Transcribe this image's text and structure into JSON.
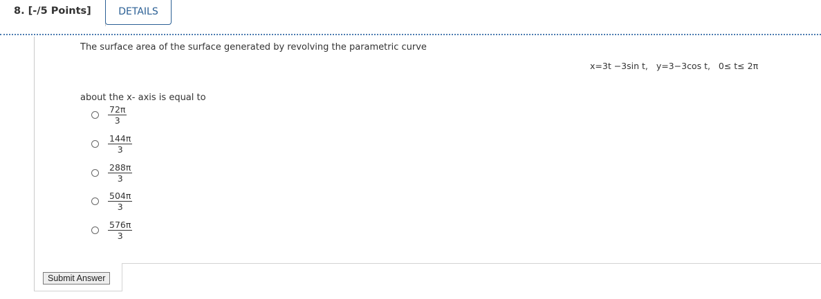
{
  "header": {
    "question_label": "8. [-/5 Points]",
    "details_label": "DETAILS"
  },
  "question": {
    "prompt": "The surface area of the surface generated by revolving the parametric curve",
    "eq_x": "x=3t −3sin t,",
    "eq_y": "y=3−3cos t,",
    "eq_range": "0≤ t≤ 2π",
    "axis_text": "about the  x- axis is equal to"
  },
  "options": [
    {
      "numerator": "72π",
      "denominator": "3",
      "selected": false
    },
    {
      "numerator": "144π",
      "denominator": "3",
      "selected": false
    },
    {
      "numerator": "288π",
      "denominator": "3",
      "selected": false
    },
    {
      "numerator": "504π",
      "denominator": "3",
      "selected": false
    },
    {
      "numerator": "576π",
      "denominator": "3",
      "selected": false
    }
  ],
  "submit_label": "Submit Answer"
}
